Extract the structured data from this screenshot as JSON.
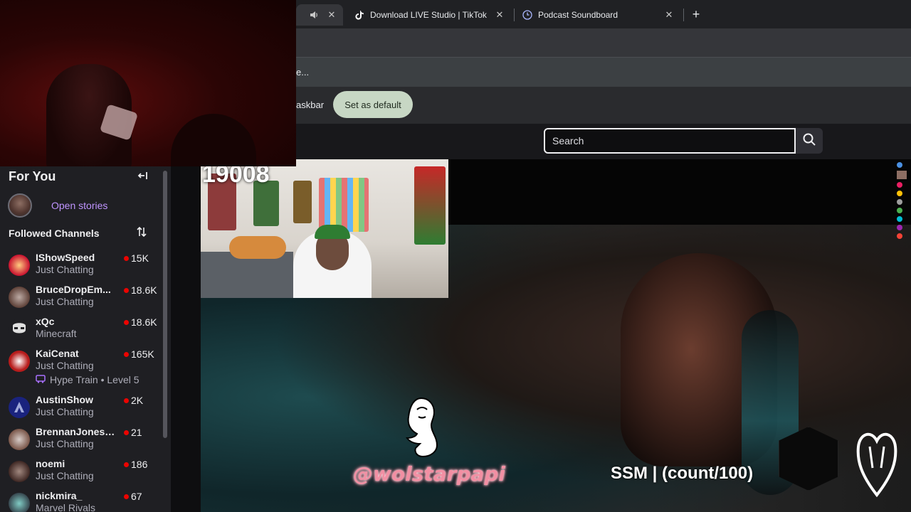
{
  "browser": {
    "tabs": [
      {
        "title": "",
        "active": true
      },
      {
        "title": "Download LIVE Studio | TikTok"
      },
      {
        "title": "Podcast Soundboard"
      }
    ],
    "infobar_text": "e...",
    "promo_text": "askbar",
    "set_default_label": "Set as default"
  },
  "search": {
    "placeholder": "Search"
  },
  "sidebar": {
    "title": "For You",
    "open_stories": "Open stories",
    "followed_title": "Followed Channels",
    "channels": [
      {
        "name": "IShowSpeed",
        "game": "Just Chatting",
        "viewers": "15K",
        "avatar_color": "#c8102e"
      },
      {
        "name": "BruceDropEm...",
        "game": "Just Chatting",
        "viewers": "18.6K",
        "avatar_color": "#8d6e63"
      },
      {
        "name": "xQc",
        "game": "Minecraft",
        "viewers": "18.6K",
        "avatar_color": "#e0e0e0"
      },
      {
        "name": "KaiCenat",
        "game": "Just Chatting",
        "viewers": "165K",
        "avatar_color": "#b71c1c"
      },
      {
        "name": "AustinShow",
        "game": "Just Chatting",
        "viewers": "2K",
        "avatar_color": "#1a237e"
      },
      {
        "name": "BrennanJonesS...",
        "game": "Just Chatting",
        "viewers": "21",
        "avatar_color": "#795548"
      },
      {
        "name": "noemi",
        "game": "Just Chatting",
        "viewers": "186",
        "avatar_color": "#4e342e"
      },
      {
        "name": "nickmira_",
        "game": "Marvel Rivals",
        "viewers": "67",
        "avatar_color": "#37474f"
      }
    ],
    "hype_train": "Hype Train • Level 5"
  },
  "stream": {
    "viewer_count": "19008",
    "handle": "@wolstarpapi",
    "goal": "SSM | (count/100)"
  },
  "colors": {
    "accent": "#bf94ff",
    "live": "#eb0400"
  }
}
